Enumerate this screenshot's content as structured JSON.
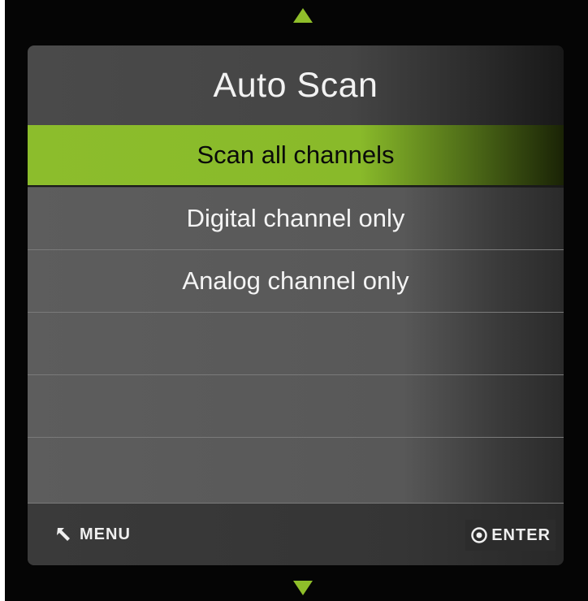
{
  "title": "Auto Scan",
  "nav": {
    "up_icon": "triangle-up-icon",
    "down_icon": "triangle-down-icon",
    "arrow_color": "#8fbe2a"
  },
  "options": [
    {
      "label": "Scan all channels",
      "selected": true
    },
    {
      "label": "Digital channel only",
      "selected": false
    },
    {
      "label": "Analog channel only",
      "selected": false
    },
    {
      "label": "",
      "selected": false
    },
    {
      "label": "",
      "selected": false
    },
    {
      "label": "",
      "selected": false
    }
  ],
  "footer": {
    "menu_label": "MENU",
    "menu_icon": "return-arrow-icon",
    "enter_label": "ENTER",
    "enter_icon": "enter-circle-icon"
  },
  "colors": {
    "accent": "#8cbd2c",
    "background": "#050505",
    "row": "#5d5d5d",
    "text": "#f4f4f4"
  }
}
